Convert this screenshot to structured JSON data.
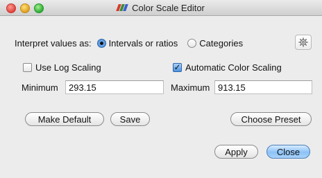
{
  "window": {
    "title": "Color Scale Editor",
    "app_icon_colors": [
      "#d93a2c",
      "#3a8a3a",
      "#3b5ecc"
    ]
  },
  "interpret": {
    "label": "Interpret values as:",
    "option_intervals": "Intervals or ratios",
    "option_categories": "Categories",
    "selected": "Intervals or ratios"
  },
  "options": {
    "log_scaling_label": "Use Log Scaling",
    "log_scaling_checked": false,
    "auto_color_label": "Automatic Color Scaling",
    "auto_color_checked": true
  },
  "range": {
    "minimum_label": "Minimum",
    "minimum_value": "293.15",
    "maximum_label": "Maximum",
    "maximum_value": "913.15"
  },
  "buttons": {
    "make_default": "Make Default",
    "save": "Save",
    "choose_preset": "Choose Preset",
    "apply": "Apply",
    "close": "Close"
  },
  "icons": {
    "settings": "gear-icon"
  }
}
